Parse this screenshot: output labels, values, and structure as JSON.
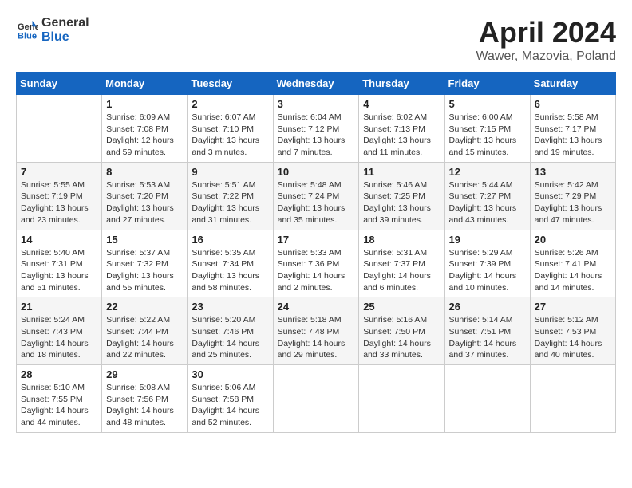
{
  "logo": {
    "general": "General",
    "blue": "Blue"
  },
  "title": "April 2024",
  "subtitle": "Wawer, Mazovia, Poland",
  "headers": [
    "Sunday",
    "Monday",
    "Tuesday",
    "Wednesday",
    "Thursday",
    "Friday",
    "Saturday"
  ],
  "weeks": [
    [
      {
        "day": "",
        "info": ""
      },
      {
        "day": "1",
        "info": "Sunrise: 6:09 AM\nSunset: 7:08 PM\nDaylight: 12 hours\nand 59 minutes."
      },
      {
        "day": "2",
        "info": "Sunrise: 6:07 AM\nSunset: 7:10 PM\nDaylight: 13 hours\nand 3 minutes."
      },
      {
        "day": "3",
        "info": "Sunrise: 6:04 AM\nSunset: 7:12 PM\nDaylight: 13 hours\nand 7 minutes."
      },
      {
        "day": "4",
        "info": "Sunrise: 6:02 AM\nSunset: 7:13 PM\nDaylight: 13 hours\nand 11 minutes."
      },
      {
        "day": "5",
        "info": "Sunrise: 6:00 AM\nSunset: 7:15 PM\nDaylight: 13 hours\nand 15 minutes."
      },
      {
        "day": "6",
        "info": "Sunrise: 5:58 AM\nSunset: 7:17 PM\nDaylight: 13 hours\nand 19 minutes."
      }
    ],
    [
      {
        "day": "7",
        "info": "Sunrise: 5:55 AM\nSunset: 7:19 PM\nDaylight: 13 hours\nand 23 minutes."
      },
      {
        "day": "8",
        "info": "Sunrise: 5:53 AM\nSunset: 7:20 PM\nDaylight: 13 hours\nand 27 minutes."
      },
      {
        "day": "9",
        "info": "Sunrise: 5:51 AM\nSunset: 7:22 PM\nDaylight: 13 hours\nand 31 minutes."
      },
      {
        "day": "10",
        "info": "Sunrise: 5:48 AM\nSunset: 7:24 PM\nDaylight: 13 hours\nand 35 minutes."
      },
      {
        "day": "11",
        "info": "Sunrise: 5:46 AM\nSunset: 7:25 PM\nDaylight: 13 hours\nand 39 minutes."
      },
      {
        "day": "12",
        "info": "Sunrise: 5:44 AM\nSunset: 7:27 PM\nDaylight: 13 hours\nand 43 minutes."
      },
      {
        "day": "13",
        "info": "Sunrise: 5:42 AM\nSunset: 7:29 PM\nDaylight: 13 hours\nand 47 minutes."
      }
    ],
    [
      {
        "day": "14",
        "info": "Sunrise: 5:40 AM\nSunset: 7:31 PM\nDaylight: 13 hours\nand 51 minutes."
      },
      {
        "day": "15",
        "info": "Sunrise: 5:37 AM\nSunset: 7:32 PM\nDaylight: 13 hours\nand 55 minutes."
      },
      {
        "day": "16",
        "info": "Sunrise: 5:35 AM\nSunset: 7:34 PM\nDaylight: 13 hours\nand 58 minutes."
      },
      {
        "day": "17",
        "info": "Sunrise: 5:33 AM\nSunset: 7:36 PM\nDaylight: 14 hours\nand 2 minutes."
      },
      {
        "day": "18",
        "info": "Sunrise: 5:31 AM\nSunset: 7:37 PM\nDaylight: 14 hours\nand 6 minutes."
      },
      {
        "day": "19",
        "info": "Sunrise: 5:29 AM\nSunset: 7:39 PM\nDaylight: 14 hours\nand 10 minutes."
      },
      {
        "day": "20",
        "info": "Sunrise: 5:26 AM\nSunset: 7:41 PM\nDaylight: 14 hours\nand 14 minutes."
      }
    ],
    [
      {
        "day": "21",
        "info": "Sunrise: 5:24 AM\nSunset: 7:43 PM\nDaylight: 14 hours\nand 18 minutes."
      },
      {
        "day": "22",
        "info": "Sunrise: 5:22 AM\nSunset: 7:44 PM\nDaylight: 14 hours\nand 22 minutes."
      },
      {
        "day": "23",
        "info": "Sunrise: 5:20 AM\nSunset: 7:46 PM\nDaylight: 14 hours\nand 25 minutes."
      },
      {
        "day": "24",
        "info": "Sunrise: 5:18 AM\nSunset: 7:48 PM\nDaylight: 14 hours\nand 29 minutes."
      },
      {
        "day": "25",
        "info": "Sunrise: 5:16 AM\nSunset: 7:50 PM\nDaylight: 14 hours\nand 33 minutes."
      },
      {
        "day": "26",
        "info": "Sunrise: 5:14 AM\nSunset: 7:51 PM\nDaylight: 14 hours\nand 37 minutes."
      },
      {
        "day": "27",
        "info": "Sunrise: 5:12 AM\nSunset: 7:53 PM\nDaylight: 14 hours\nand 40 minutes."
      }
    ],
    [
      {
        "day": "28",
        "info": "Sunrise: 5:10 AM\nSunset: 7:55 PM\nDaylight: 14 hours\nand 44 minutes."
      },
      {
        "day": "29",
        "info": "Sunrise: 5:08 AM\nSunset: 7:56 PM\nDaylight: 14 hours\nand 48 minutes."
      },
      {
        "day": "30",
        "info": "Sunrise: 5:06 AM\nSunset: 7:58 PM\nDaylight: 14 hours\nand 52 minutes."
      },
      {
        "day": "",
        "info": ""
      },
      {
        "day": "",
        "info": ""
      },
      {
        "day": "",
        "info": ""
      },
      {
        "day": "",
        "info": ""
      }
    ]
  ]
}
